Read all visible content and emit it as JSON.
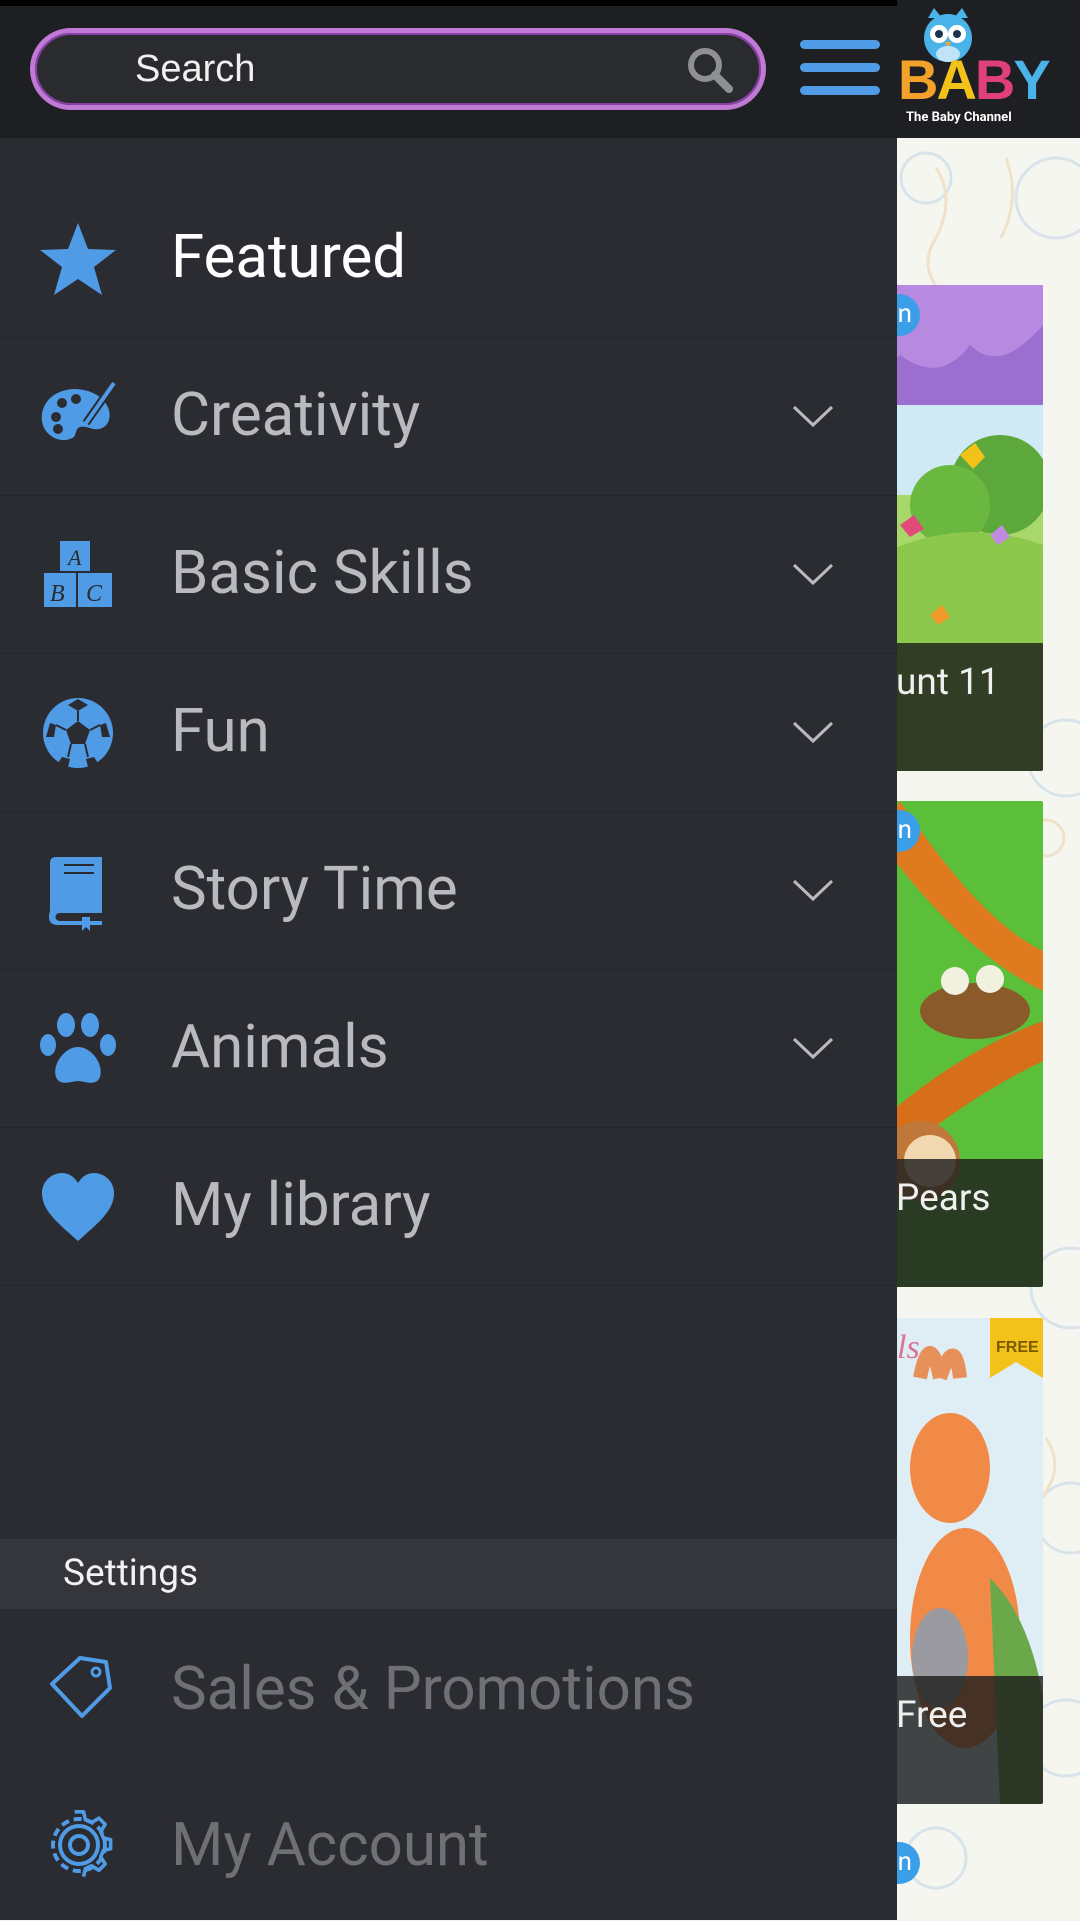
{
  "header": {
    "search_placeholder": "Search",
    "logo_text": "BABY",
    "logo_subtitle": "The Baby Channel"
  },
  "drawer": {
    "items": [
      {
        "label": "Featured",
        "icon": "star-icon",
        "expandable": false,
        "active": true
      },
      {
        "label": "Creativity",
        "icon": "palette-icon",
        "expandable": true
      },
      {
        "label": "Basic Skills",
        "icon": "abc-blocks-icon",
        "expandable": true
      },
      {
        "label": "Fun",
        "icon": "soccer-ball-icon",
        "expandable": true
      },
      {
        "label": "Story Time",
        "icon": "book-icon",
        "expandable": true
      },
      {
        "label": "Animals",
        "icon": "paw-icon",
        "expandable": true
      },
      {
        "label": "My library",
        "icon": "heart-icon",
        "expandable": false
      }
    ],
    "settings_header": "Settings",
    "settings_items": [
      {
        "label": "Sales & Promotions",
        "icon": "tag-icon"
      },
      {
        "label": "My Account",
        "icon": "gear-icon"
      }
    ]
  },
  "background_cards": [
    {
      "caption": "unt 11",
      "badge": "n"
    },
    {
      "caption": "Pears",
      "badge": "n"
    },
    {
      "caption": "Free",
      "badge": "FREE",
      "title_fragment": "als"
    }
  ],
  "colors": {
    "accent_blue": "#4f9be6",
    "drawer_bg": "#2b2c31",
    "header_bg": "#1e1f22",
    "search_border": "#c07ad6",
    "label_text": "#b9babf",
    "active_label": "#ffffff",
    "settings_label": "#6f7075"
  }
}
